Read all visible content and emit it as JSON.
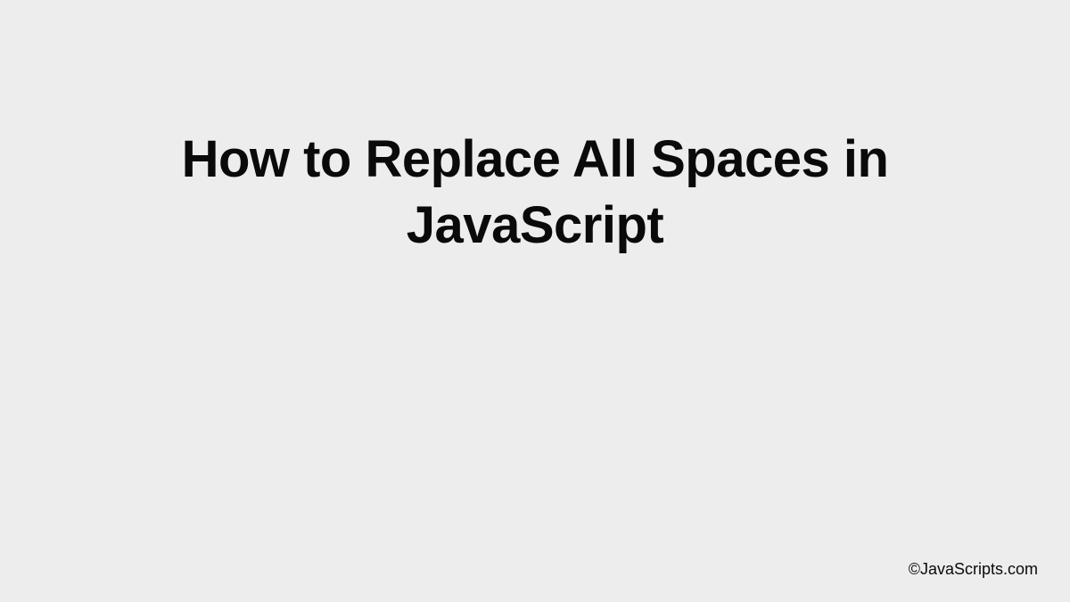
{
  "title": "How to Replace All Spaces in JavaScript",
  "attribution": "©JavaScripts.com"
}
